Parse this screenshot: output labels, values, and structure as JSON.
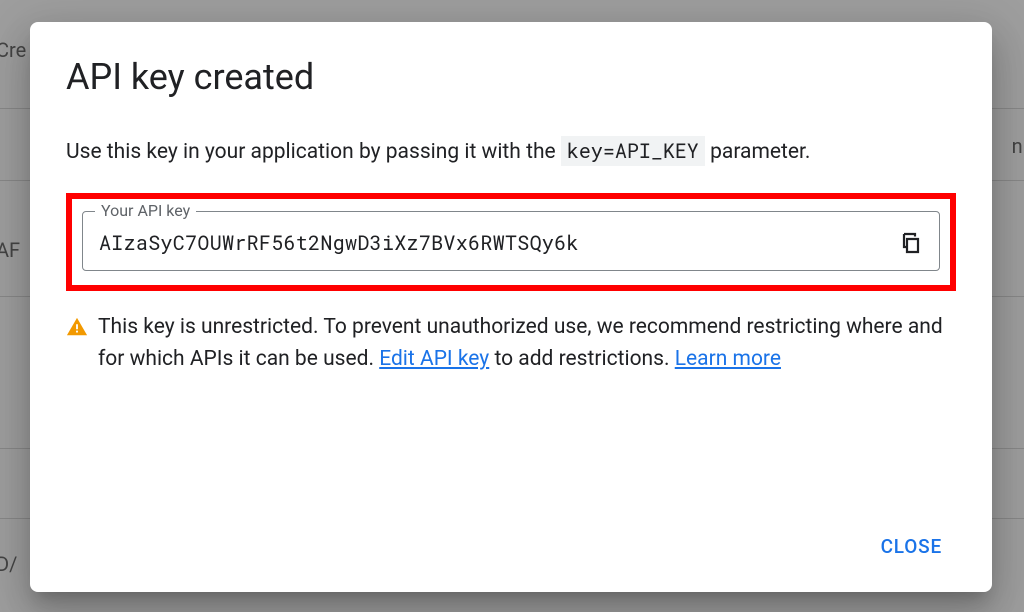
{
  "background": {
    "text1": "Cre",
    "text2": "n.",
    "text3": "AF",
    "text4": "D/"
  },
  "modal": {
    "title": "API key created",
    "description_prefix": "Use this key in your application by passing it with the ",
    "description_param": "key=API_KEY",
    "description_suffix": " parameter.",
    "field_label": "Your API key",
    "api_key": "AIzaSyC7OUWrRF56t2NgwD3iXz7BVx6RWTSQy6k",
    "warning_text": "This key is unrestricted. To prevent unauthorized use, we recommend restricting where and for which APIs it can be used. ",
    "edit_link": "Edit API key",
    "warning_mid": " to add restrictions. ",
    "learn_more": "Learn more",
    "close_label": "CLOSE"
  }
}
